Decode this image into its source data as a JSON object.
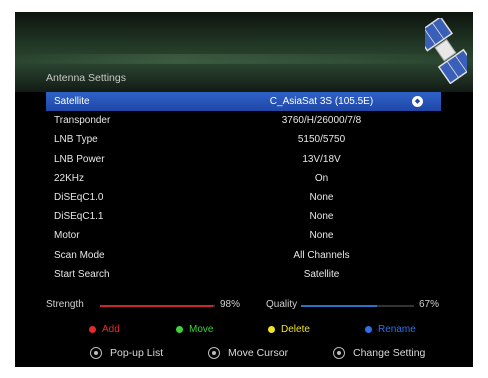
{
  "header": {
    "title": "Antenna Settings"
  },
  "settings": [
    {
      "label": "Satellite",
      "value": "C_AsiaSat 3S (105.5E)",
      "selected": true
    },
    {
      "label": "Transponder",
      "value": "3760/H/26000/7/8"
    },
    {
      "label": "LNB Type",
      "value": "5150/5750"
    },
    {
      "label": "LNB Power",
      "value": "13V/18V"
    },
    {
      "label": "22KHz",
      "value": "On"
    },
    {
      "label": "DiSEqC1.0",
      "value": "None"
    },
    {
      "label": "DiSEqC1.1",
      "value": "None"
    },
    {
      "label": "Motor",
      "value": "None"
    },
    {
      "label": "Scan Mode",
      "value": "All Channels"
    },
    {
      "label": "Start Search",
      "value": "Satellite"
    }
  ],
  "signal": {
    "strength": {
      "label": "Strength",
      "value": 98,
      "text": "98%",
      "color": "#c8262a"
    },
    "quality": {
      "label": "Quality",
      "value": 67,
      "text": "67%",
      "color": "#2a73c8"
    }
  },
  "color_buttons": [
    {
      "label": "Add",
      "color": "#e8292c"
    },
    {
      "label": "Move",
      "color": "#3fd13b"
    },
    {
      "label": "Delete",
      "color": "#f0e12a"
    },
    {
      "label": "Rename",
      "color": "#2f6fe8"
    }
  ],
  "hints": [
    {
      "label": "Pop-up List",
      "icon": "ok-button-icon"
    },
    {
      "label": "Move Cursor",
      "icon": "navigation-pad-icon"
    },
    {
      "label": "Change Setting",
      "icon": "left-right-icon"
    }
  ]
}
